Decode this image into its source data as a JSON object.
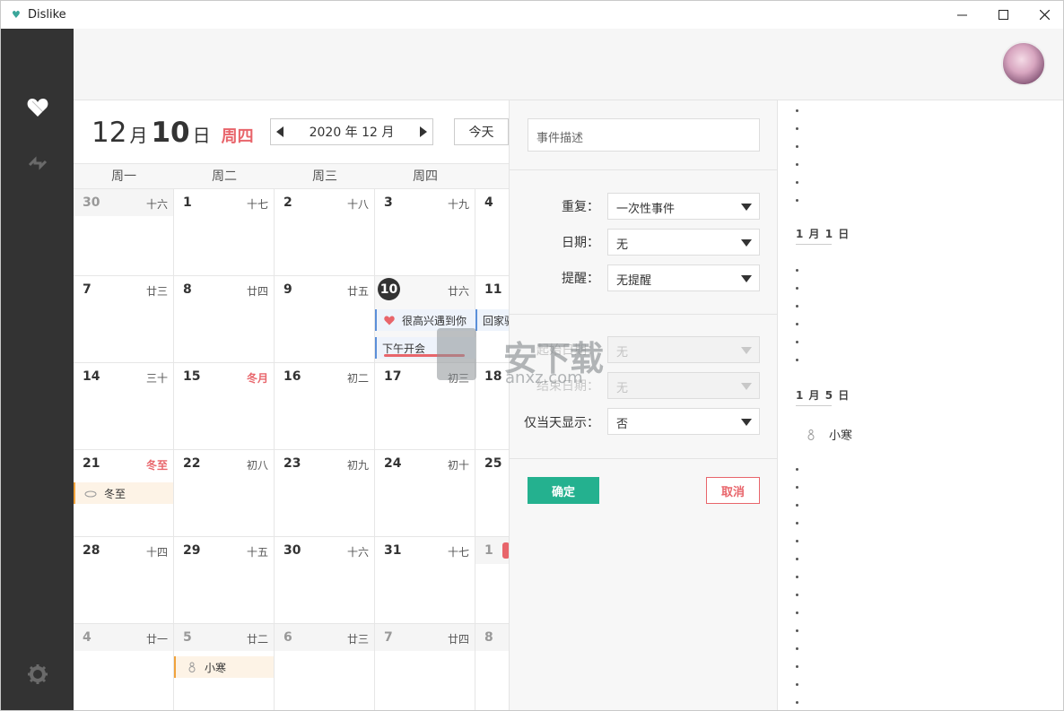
{
  "window": {
    "title": "Dislike"
  },
  "calendar": {
    "month": "12",
    "month_unit": "月",
    "day": "10",
    "day_unit": "日",
    "weekday": "周四",
    "nav_label": "2020 年 12 月",
    "today_label": "今天",
    "weekdays": [
      "周一",
      "周二",
      "周三",
      "周四"
    ],
    "weeks": [
      [
        {
          "d": "30",
          "l": "十六",
          "other": true
        },
        {
          "d": "1",
          "l": "十七"
        },
        {
          "d": "2",
          "l": "十八"
        },
        {
          "d": "3",
          "l": "十九"
        },
        {
          "d": "4",
          "l": ""
        }
      ],
      [
        {
          "d": "7",
          "l": "廿三"
        },
        {
          "d": "8",
          "l": "廿四"
        },
        {
          "d": "9",
          "l": "廿五"
        },
        {
          "d": "10",
          "l": "廿六",
          "today": true
        },
        {
          "d": "11",
          "l": ""
        }
      ],
      [
        {
          "d": "14",
          "l": "三十"
        },
        {
          "d": "15",
          "l": "冬月",
          "red": true
        },
        {
          "d": "16",
          "l": "初二"
        },
        {
          "d": "17",
          "l": "初三"
        },
        {
          "d": "18",
          "l": ""
        }
      ],
      [
        {
          "d": "21",
          "l": "冬至",
          "red": true
        },
        {
          "d": "22",
          "l": "初八"
        },
        {
          "d": "23",
          "l": "初九"
        },
        {
          "d": "24",
          "l": "初十"
        },
        {
          "d": "25",
          "l": ""
        }
      ],
      [
        {
          "d": "28",
          "l": "十四"
        },
        {
          "d": "29",
          "l": "十五"
        },
        {
          "d": "30",
          "l": "十六"
        },
        {
          "d": "31",
          "l": "十七"
        },
        {
          "d": "1",
          "l": "",
          "other": true
        }
      ],
      [
        {
          "d": "4",
          "l": "廿一",
          "other": true
        },
        {
          "d": "5",
          "l": "廿二",
          "other": true
        },
        {
          "d": "6",
          "l": "廿三",
          "other": true
        },
        {
          "d": "7",
          "l": "廿四",
          "other": true
        },
        {
          "d": "8",
          "l": "",
          "other": true
        }
      ]
    ],
    "events": {
      "ev1": "很高兴遇到你",
      "ev2": "回家骑",
      "ev3": "下午开会",
      "ev4": "冬至",
      "ev5": "小寒"
    }
  },
  "form": {
    "description_placeholder": "事件描述",
    "repeat_label": "重复：",
    "repeat_value": "一次性事件",
    "date_label": "日期：",
    "date_value": "无",
    "remind_label": "提醒：",
    "remind_value": "无提醒",
    "start_label": "起始日期：",
    "start_value": "无",
    "end_label": "结束日期：",
    "end_value": "无",
    "sameday_label": "仅当天显示：",
    "sameday_value": "否",
    "ok_label": "确定",
    "cancel_label": "取消"
  },
  "watermark": {
    "text": "安下载",
    "sub": "anxz.com"
  },
  "list": {
    "h1": "1 月 1 日",
    "h2": "1 月 5 日",
    "item1": "小寒"
  },
  "colors": {
    "accent_red": "#e8656b",
    "accent_green": "#24b18f",
    "sidebar": "#333333",
    "event_blue": "#5b8fd9",
    "event_orange": "#f0a23c"
  }
}
